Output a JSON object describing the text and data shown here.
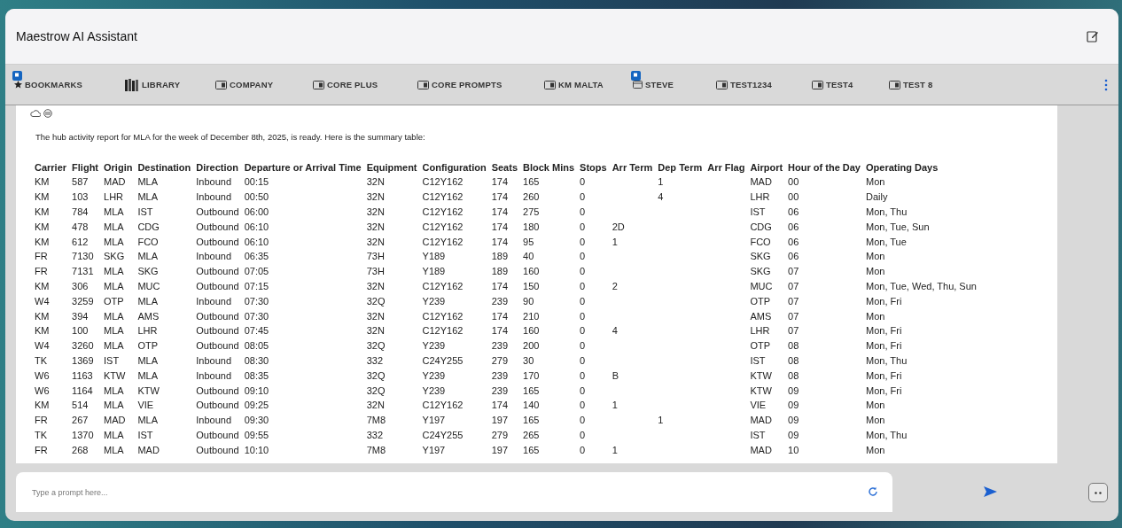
{
  "window": {
    "title": "Maestrow AI Assistant"
  },
  "tabs": [
    {
      "label": "BOOKMARKS",
      "kind": "bookmarks",
      "badge": true
    },
    {
      "label": "LIBRARY",
      "kind": "library",
      "badge": false
    },
    {
      "label": "COMPANY",
      "kind": "folder",
      "badge": false
    },
    {
      "label": "CORE PLUS",
      "kind": "folder",
      "badge": false
    },
    {
      "label": "CORE PROMPTS",
      "kind": "folder",
      "badge": false
    },
    {
      "label": "KM MALTA",
      "kind": "folder",
      "badge": false
    },
    {
      "label": "STEVE",
      "kind": "window",
      "badge": true
    },
    {
      "label": "TEST1234",
      "kind": "folder",
      "badge": false
    },
    {
      "label": "TEST4",
      "kind": "folder",
      "badge": false
    },
    {
      "label": "TEST 8",
      "kind": "folder",
      "badge": false
    }
  ],
  "message": {
    "text": "The hub activity report for MLA for the week of December 8th, 2025, is ready. Here is the summary table:",
    "table": {
      "columns": [
        "Carrier",
        "Flight",
        "Origin",
        "Destination",
        "Direction",
        "Departure or Arrival Time",
        "Equipment",
        "Configuration",
        "Seats",
        "Block Mins",
        "Stops",
        "Arr Term",
        "Dep Term",
        "Arr Flag",
        "Airport",
        "Hour of the Day",
        "Operating Days"
      ],
      "rows": [
        [
          "KM",
          "587",
          "MAD",
          "MLA",
          "Inbound",
          "00:15",
          "32N",
          "C12Y162",
          "174",
          "165",
          "0",
          null,
          "1",
          null,
          "MAD",
          "00",
          "Mon"
        ],
        [
          "KM",
          "103",
          "LHR",
          "MLA",
          "Inbound",
          "00:50",
          "32N",
          "C12Y162",
          "174",
          "260",
          "0",
          null,
          "4",
          null,
          "LHR",
          "00",
          "Daily"
        ],
        [
          "KM",
          "784",
          "MLA",
          "IST",
          "Outbound",
          "06:00",
          "32N",
          "C12Y162",
          "174",
          "275",
          "0",
          null,
          null,
          null,
          "IST",
          "06",
          "Mon, Thu"
        ],
        [
          "KM",
          "478",
          "MLA",
          "CDG",
          "Outbound",
          "06:10",
          "32N",
          "C12Y162",
          "174",
          "180",
          "0",
          "2D",
          null,
          null,
          "CDG",
          "06",
          "Mon, Tue, Sun"
        ],
        [
          "KM",
          "612",
          "MLA",
          "FCO",
          "Outbound",
          "06:10",
          "32N",
          "C12Y162",
          "174",
          "95",
          "0",
          "1",
          null,
          null,
          "FCO",
          "06",
          "Mon, Tue"
        ],
        [
          "FR",
          "7130",
          "SKG",
          "MLA",
          "Inbound",
          "06:35",
          "73H",
          "Y189",
          "189",
          "40",
          "0",
          null,
          null,
          null,
          "SKG",
          "06",
          "Mon"
        ],
        [
          "FR",
          "7131",
          "MLA",
          "SKG",
          "Outbound",
          "07:05",
          "73H",
          "Y189",
          "189",
          "160",
          "0",
          null,
          null,
          null,
          "SKG",
          "07",
          "Mon"
        ],
        [
          "KM",
          "306",
          "MLA",
          "MUC",
          "Outbound",
          "07:15",
          "32N",
          "C12Y162",
          "174",
          "150",
          "0",
          "2",
          null,
          null,
          "MUC",
          "07",
          "Mon, Tue, Wed, Thu, Sun"
        ],
        [
          "W4",
          "3259",
          "OTP",
          "MLA",
          "Inbound",
          "07:30",
          "32Q",
          "Y239",
          "239",
          "90",
          "0",
          null,
          null,
          null,
          "OTP",
          "07",
          "Mon, Fri"
        ],
        [
          "KM",
          "394",
          "MLA",
          "AMS",
          "Outbound",
          "07:30",
          "32N",
          "C12Y162",
          "174",
          "210",
          "0",
          null,
          null,
          null,
          "AMS",
          "07",
          "Mon"
        ],
        [
          "KM",
          "100",
          "MLA",
          "LHR",
          "Outbound",
          "07:45",
          "32N",
          "C12Y162",
          "174",
          "160",
          "0",
          "4",
          null,
          null,
          "LHR",
          "07",
          "Mon, Fri"
        ],
        [
          "W4",
          "3260",
          "MLA",
          "OTP",
          "Outbound",
          "08:05",
          "32Q",
          "Y239",
          "239",
          "200",
          "0",
          null,
          null,
          null,
          "OTP",
          "08",
          "Mon, Fri"
        ],
        [
          "TK",
          "1369",
          "IST",
          "MLA",
          "Inbound",
          "08:30",
          "332",
          "C24Y255",
          "279",
          "30",
          "0",
          null,
          null,
          null,
          "IST",
          "08",
          "Mon, Thu"
        ],
        [
          "W6",
          "1163",
          "KTW",
          "MLA",
          "Inbound",
          "08:35",
          "32Q",
          "Y239",
          "239",
          "170",
          "0",
          "B",
          null,
          null,
          "KTW",
          "08",
          "Mon, Fri"
        ],
        [
          "W6",
          "1164",
          "MLA",
          "KTW",
          "Outbound",
          "09:10",
          "32Q",
          "Y239",
          "239",
          "165",
          "0",
          null,
          null,
          null,
          "KTW",
          "09",
          "Mon, Fri"
        ],
        [
          "KM",
          "514",
          "MLA",
          "VIE",
          "Outbound",
          "09:25",
          "32N",
          "C12Y162",
          "174",
          "140",
          "0",
          "1",
          null,
          null,
          "VIE",
          "09",
          "Mon"
        ],
        [
          "FR",
          "267",
          "MAD",
          "MLA",
          "Inbound",
          "09:30",
          "7M8",
          "Y197",
          "197",
          "165",
          "0",
          null,
          "1",
          null,
          "MAD",
          "09",
          "Mon"
        ],
        [
          "TK",
          "1370",
          "MLA",
          "IST",
          "Outbound",
          "09:55",
          "332",
          "C24Y255",
          "279",
          "265",
          "0",
          null,
          null,
          null,
          "IST",
          "09",
          "Mon, Thu"
        ],
        [
          "FR",
          "268",
          "MLA",
          "MAD",
          "Outbound",
          "10:10",
          "7M8",
          "Y197",
          "197",
          "165",
          "0",
          "1",
          null,
          null,
          "MAD",
          "10",
          "Mon"
        ]
      ]
    }
  },
  "prompt": {
    "placeholder": "Type a prompt here..."
  }
}
